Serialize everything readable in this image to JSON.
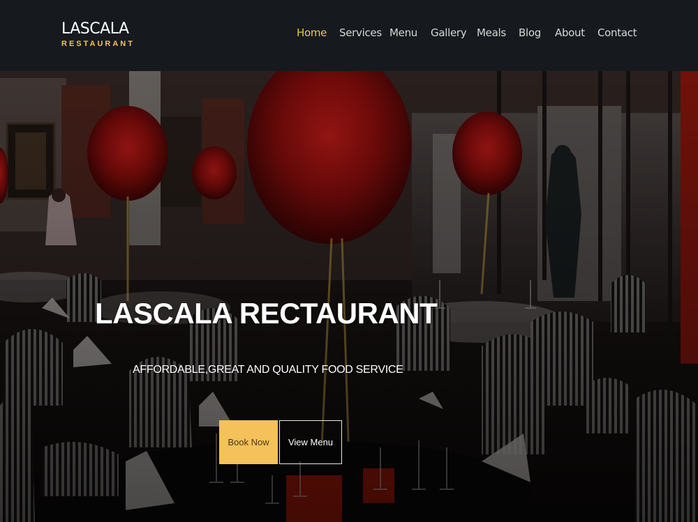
{
  "brand": {
    "name": "LASCALA",
    "tagline": "RESTAURANT"
  },
  "nav": {
    "items": [
      {
        "label": "Home",
        "active": true
      },
      {
        "label": "Services",
        "active": false
      },
      {
        "label": "Menu",
        "active": false
      },
      {
        "label": "Gallery",
        "active": false
      },
      {
        "label": "Meals",
        "active": false
      },
      {
        "label": "Blog",
        "active": false
      },
      {
        "label": "About",
        "active": false
      },
      {
        "label": "Contact",
        "active": false
      }
    ]
  },
  "hero": {
    "title": "LASCALA RECTAURANT",
    "subtitle": "AFFORDABLE,GREAT AND QUALITY FOOD SERVICE",
    "primary_button": "Book Now",
    "secondary_button": "View Menu"
  },
  "colors": {
    "navbar_bg": "#161a1e",
    "accent": "#f5c15a",
    "active_nav": "#f2c356",
    "text": "#ffffff"
  }
}
